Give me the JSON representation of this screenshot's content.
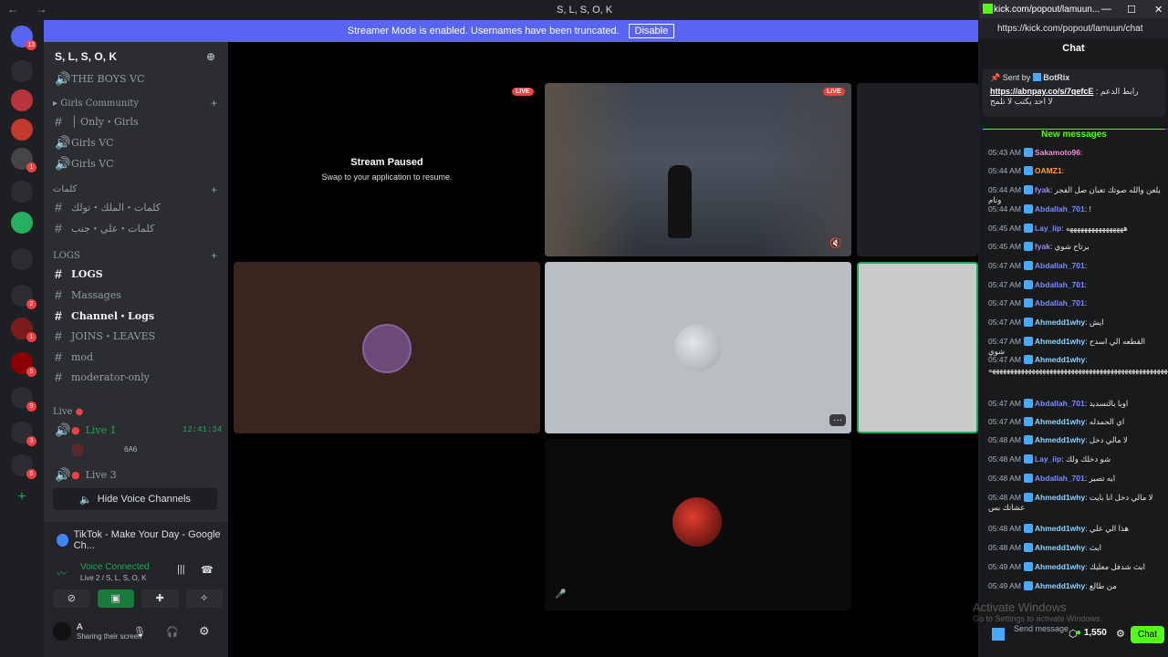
{
  "window": {
    "title": "S, L, S, O, K"
  },
  "banner": {
    "text": "Streamer Mode is enabled. Usernames have been truncated.",
    "button": "Disable"
  },
  "guilds": {
    "badges": [
      "13",
      "1",
      "2",
      "1",
      "5",
      "9",
      "3",
      "5"
    ]
  },
  "server": {
    "name": "S, L, S, O, K"
  },
  "channels": {
    "boys_vc": "THE BOYS VC",
    "girls_cat": "Girls Community",
    "only_girls": "│ Only・Girls",
    "girls_vc1": "Girls VC",
    "girls_vc2": "Girls VC",
    "arabic_cat": "كلمات",
    "arabic1": "كلمات・الملك・تولك",
    "arabic2": "كلمات・علي・جنب",
    "logs_cat": "LOGS",
    "logs": "LOGS",
    "massages": "Massages",
    "channel_logs": "Channel・Logs",
    "joins": "JOINS・LEAVES",
    "mod": "mod",
    "mod_only": "moderator-only",
    "live_cat": "Live",
    "live1": "Live 1",
    "live1_time": "12:41:34",
    "live1_user": "6A6",
    "live3": "Live 3",
    "hide_vc": "Hide Voice Channels"
  },
  "panel": {
    "tiktok": "TikTok - Make Your Day - Google Ch...",
    "vc_status": "Voice Connected",
    "vc_channel": "Live 2 / S, L, S, O, K",
    "user": "A",
    "user_status": "Sharing their screen"
  },
  "stage": {
    "paused_title": "Stream Paused",
    "paused_sub": "Swap to your application to resume.",
    "live": "LIVE"
  },
  "chat": {
    "tab": "kick.com/popout/lamuun...",
    "url": "https://kick.com/popout/lamuun/chat",
    "header": "Chat",
    "pinned_by": "Sent by",
    "pinned_user": "BotRix",
    "pinned_link": "https://abnpay.co/s/7qefcE",
    "pinned_text": ": رابط الدعم",
    "pinned_text2": "لا احد يكتب لا تلمح",
    "new_messages": "New messages",
    "messages": [
      {
        "t": "05:43 AM",
        "u": "Sakamoto96",
        "c": "#f38cd6",
        "m": ""
      },
      {
        "t": "05:44 AM",
        "u": "OAMZ1",
        "c": "#ff9f3c",
        "m": ""
      },
      {
        "t": "05:44 AM",
        "u": "fyak",
        "c": "#9b8cff",
        "m": "يلعن والله صوتك تعبان صل الفجر ونام"
      },
      {
        "t": "05:44 AM",
        "u": "Abdallah_701",
        "c": "#7c8cff",
        "m": "!"
      },
      {
        "t": "05:45 AM",
        "u": "Lay_iip",
        "c": "#7c8cff",
        "m": "ههههههههههههههههه"
      },
      {
        "t": "05:45 AM",
        "u": "fyak",
        "c": "#9b8cff",
        "m": "برتاح شوي"
      },
      {
        "t": "05:47 AM",
        "u": "Abdallah_701",
        "c": "#7c8cff",
        "m": ""
      },
      {
        "t": "05:47 AM",
        "u": "Abdallah_701",
        "c": "#7c8cff",
        "m": ""
      },
      {
        "t": "05:47 AM",
        "u": "Abdallah_701",
        "c": "#7c8cff",
        "m": ""
      },
      {
        "t": "05:47 AM",
        "u": "Ahmedd1why",
        "c": "#8fd3ff",
        "m": "ايش"
      },
      {
        "t": "05:47 AM",
        "u": "Ahmedd1why",
        "c": "#8fd3ff",
        "m": "القطعه الي اسدح شوي"
      },
      {
        "t": "05:47 AM",
        "u": "Ahmedd1why",
        "c": "#8fd3ff",
        "m": "ههههههههههههههههههههههههههههههههههههههههههههههههههه"
      },
      {
        "t": "05:47 AM",
        "u": "Abdallah_701",
        "c": "#7c8cff",
        "m": "اوبا بالتسديد"
      },
      {
        "t": "05:47 AM",
        "u": "Ahmedd1why",
        "c": "#8fd3ff",
        "m": "اي الحمدله"
      },
      {
        "t": "05:48 AM",
        "u": "Ahmedd1why",
        "c": "#8fd3ff",
        "m": "لا مالي دخل"
      },
      {
        "t": "05:48 AM",
        "u": "Lay_iip",
        "c": "#7c8cff",
        "m": "شو دخلك ولك"
      },
      {
        "t": "05:48 AM",
        "u": "Abdallah_701",
        "c": "#7c8cff",
        "m": "ايه تصير"
      },
      {
        "t": "05:48 AM",
        "u": "Ahmedd1why",
        "c": "#8fd3ff",
        "m": "لا مالي دخل انا بايت عشانك بس"
      },
      {
        "t": "05:48 AM",
        "u": "Ahmedd1why",
        "c": "#8fd3ff",
        "m": "هذا الي علي"
      },
      {
        "t": "05:48 AM",
        "u": "Ahmedd1why",
        "c": "#8fd3ff",
        "m": "ابث"
      },
      {
        "t": "05:49 AM",
        "u": "Ahmedd1why",
        "c": "#8fd3ff",
        "m": "ابث شدفل معليك"
      },
      {
        "t": "05:49 AM",
        "u": "Ahmedd1why",
        "c": "#8fd3ff",
        "m": "من طالع"
      }
    ],
    "send_placeholder": "Send message",
    "points": "1,550",
    "chat_button": "Chat"
  },
  "watermark": {
    "line1": "Activate Windows",
    "line2": "Go to Settings to activate Windows."
  }
}
